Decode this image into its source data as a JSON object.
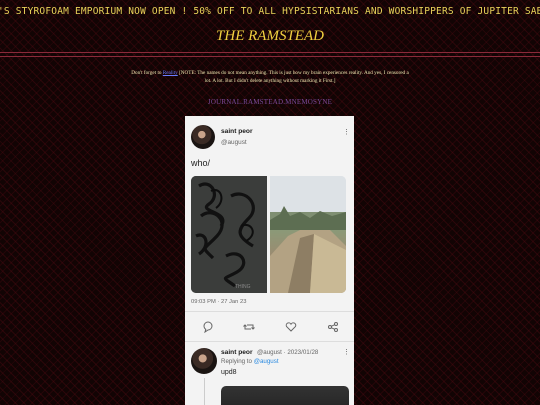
{
  "marquee": {
    "text": "'S STYROFOAM EMPORIUM NOW OPEN ! 50% OFF TO ALL HYPSISTARIANS AND WORSHIPPERS OF JUPITER SABAZIUS ! BRING"
  },
  "site": {
    "title": "THE RAMSTEAD"
  },
  "note": {
    "prefix": "Don't forget to",
    "link_text": "Reality",
    "body": "[NOTE: The names do not mean anything. This is just how my brain experiences reality. And yes, I censored a lot. A lot. But I didn't delete anything without marking it First.]"
  },
  "nav": {
    "journal_link": "JOURNAL.RAMSTEAD.MNEMOSYNE"
  },
  "tweet": {
    "name": "saint peor",
    "handle": "@august",
    "text": "who/",
    "timestamp": "09:03 PM · 27 Jan 23",
    "images": [
      {
        "description": "photo-1",
        "icon": "graffiti-wall-photo"
      },
      {
        "description": "photo-2",
        "icon": "overlook-photo"
      }
    ],
    "actions": [
      {
        "name": "reply",
        "icon": "comment-icon"
      },
      {
        "name": "retweet",
        "icon": "retweet-icon"
      },
      {
        "name": "like",
        "icon": "heart-icon"
      },
      {
        "name": "share",
        "icon": "share-icon"
      }
    ]
  },
  "reply": {
    "name": "saint peor",
    "meta": "@august · 2023/01/28",
    "replying_label": "Replying to",
    "replying_to": "@august",
    "text": "upd8"
  },
  "colors": {
    "background": "#120404",
    "text_yellow": "#e8d35a",
    "link_blue": "#6a7cff",
    "journal_purple": "#7a4a9a",
    "rule": "#8a2a3a",
    "card_bg": "#f3f3f3"
  }
}
